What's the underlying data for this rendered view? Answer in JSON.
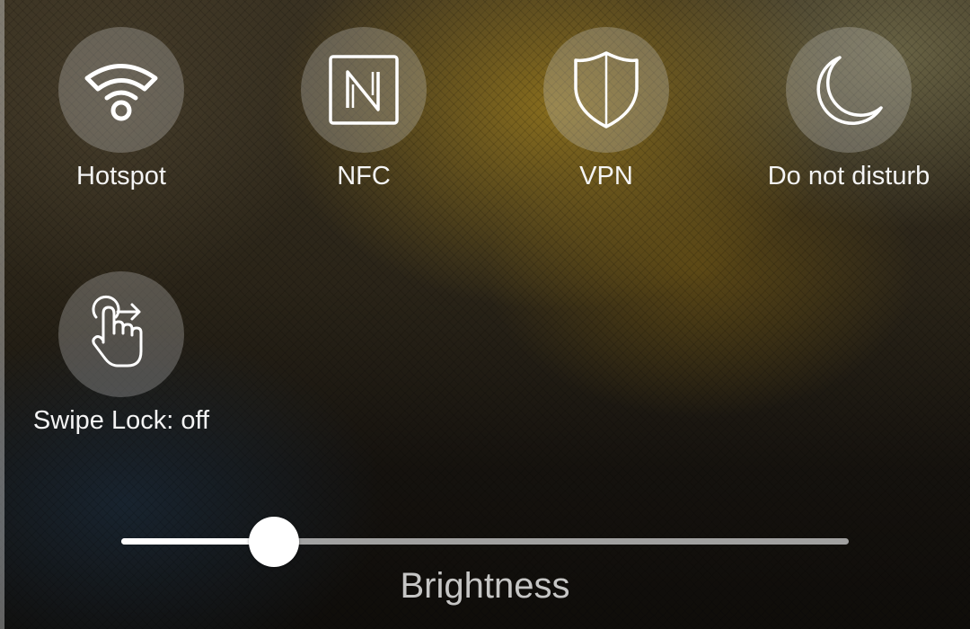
{
  "quick_settings": {
    "tiles": [
      {
        "label": "Hotspot",
        "icon": "hotspot-icon"
      },
      {
        "label": "NFC",
        "icon": "nfc-icon"
      },
      {
        "label": "VPN",
        "icon": "vpn-shield-icon"
      },
      {
        "label": "Do not disturb",
        "icon": "moon-icon"
      },
      {
        "label": "Swipe Lock: off",
        "icon": "swipe-lock-icon"
      }
    ]
  },
  "brightness": {
    "label": "Brightness",
    "level_percent": 21
  },
  "colors": {
    "tile_circle": "rgba(200,200,200,0.30)",
    "icon_stroke": "#ffffff",
    "slider_fill": "#ffffff",
    "slider_track": "#d2d2d2"
  }
}
